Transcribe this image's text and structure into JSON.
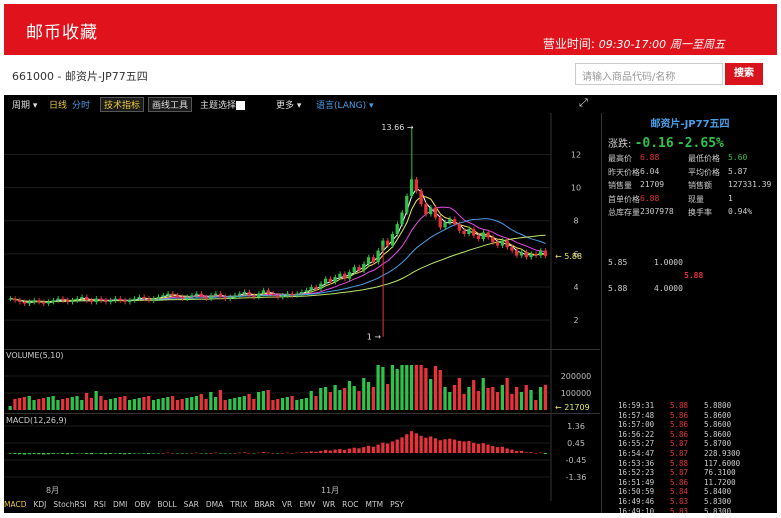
{
  "header": {
    "brand": "邮币收藏",
    "hours_label": "营业时间:",
    "hours_time": "09:30-17:00",
    "hours_days": "周一至周五",
    "bg_color": "#e0131c"
  },
  "topbar": {
    "product_code": "661000 - 邮资片-JP77五四",
    "search_placeholder": "请输入商品代码/名称",
    "search_button": "搜索"
  },
  "toolbar": {
    "period": "周期",
    "daily": "日线",
    "timeshare": "分时",
    "indicators": "技术指标",
    "draw_tools": "画线工具",
    "theme": "主题选择",
    "more": "更多",
    "language": "语言(LANG)",
    "fullscreen_icon": "expand-icon"
  },
  "quote": {
    "title": "邮资片-JP77五四",
    "change_label": "涨跌:",
    "change_value": "-0.16",
    "change_pct": "-2.65%",
    "rows": [
      {
        "k1": "最高价",
        "v1": "6.88",
        "k2": "最低价格",
        "v2": "5.60"
      },
      {
        "k1": "昨天价格",
        "v1": "6.04",
        "k2": "平均价格",
        "v2": "5.87"
      },
      {
        "k1": "销售量",
        "v1": "21709",
        "k2": "销售额",
        "v2": "127331.39"
      },
      {
        "k1": "首单价格",
        "v1": "6.88",
        "k2": "现量",
        "v2": "1"
      },
      {
        "k1": "总库存量",
        "v1": "2307978",
        "k2": "换手率",
        "v2": "0.94%"
      }
    ]
  },
  "order_book": {
    "sell": {
      "price": "5.85",
      "qty": "1.0000"
    },
    "last": "5.88",
    "buy": {
      "price": "5.88",
      "qty": "4.0000"
    }
  },
  "ticks": [
    {
      "time": "16:59:31",
      "price": "5.88",
      "vol": "5.8800"
    },
    {
      "time": "16:57:48",
      "price": "5.86",
      "vol": "5.8600"
    },
    {
      "time": "16:57:00",
      "price": "5.86",
      "vol": "5.8600"
    },
    {
      "time": "16:56:22",
      "price": "5.86",
      "vol": "5.8600"
    },
    {
      "time": "16:55:27",
      "price": "5.87",
      "vol": "5.8700"
    },
    {
      "time": "16:54:47",
      "price": "5.87",
      "vol": "228.9300"
    },
    {
      "time": "16:53:36",
      "price": "5.88",
      "vol": "117.6000"
    },
    {
      "time": "16:52:23",
      "price": "5.87",
      "vol": "76.3100"
    },
    {
      "time": "16:51:49",
      "price": "5.86",
      "vol": "11.7200"
    },
    {
      "time": "16:50:59",
      "price": "5.84",
      "vol": "5.8400"
    },
    {
      "time": "16:49:46",
      "price": "5.83",
      "vol": "5.8300"
    },
    {
      "time": "16:49:10",
      "price": "5.83",
      "vol": "5.8300"
    }
  ],
  "panels": {
    "volume_label": "VOLUME(5,10)",
    "macd_label": "MACD(12,26,9)"
  },
  "bottom_tabs": [
    "MACD",
    "KDJ",
    "StochRSI",
    "RSI",
    "DMI",
    "OBV",
    "BOLL",
    "SAR",
    "DMA",
    "TRIX",
    "BRAR",
    "VR",
    "EMV",
    "WR",
    "ROC",
    "MTM",
    "PSY"
  ],
  "chart_data": {
    "type": "candlestick",
    "x_labels": [
      "8月",
      "11月"
    ],
    "price_axis_ticks": [
      "2",
      "4",
      "6",
      "8",
      "10",
      "12"
    ],
    "price_range": [
      0.5,
      13.9
    ],
    "high_annotation": "13.66",
    "low_annotation": "1",
    "last_price": "5.88",
    "volume_axis_ticks": [
      "200000",
      "100000"
    ],
    "volume_last": "21709",
    "macd_axis_ticks": [
      "1.36",
      "0.45",
      "-0.45",
      "-1.36"
    ],
    "closes": [
      3.3,
      3.2,
      3.1,
      3.0,
      3.1,
      3.2,
      3.1,
      3.0,
      3.1,
      3.2,
      3.3,
      3.2,
      3.1,
      3.2,
      3.3,
      3.4,
      3.2,
      3.1,
      3.3,
      3.2,
      3.1,
      3.2,
      3.3,
      3.2,
      3.1,
      3.2,
      3.3,
      3.4,
      3.3,
      3.2,
      3.3,
      3.4,
      3.5,
      3.6,
      3.5,
      3.4,
      3.3,
      3.4,
      3.5,
      3.6,
      3.4,
      3.3,
      3.5,
      3.6,
      3.4,
      3.3,
      3.4,
      3.5,
      3.6,
      3.7,
      3.5,
      3.4,
      3.6,
      3.8,
      3.6,
      3.5,
      3.4,
      3.5,
      3.6,
      3.5,
      3.6,
      3.7,
      3.8,
      4.0,
      3.9,
      4.2,
      4.5,
      4.3,
      4.6,
      4.8,
      4.5,
      4.9,
      5.2,
      5.0,
      5.4,
      5.8,
      5.5,
      6.2,
      6.8,
      6.5,
      7.2,
      7.8,
      8.5,
      9.5,
      10.5,
      9.8,
      9.0,
      8.4,
      8.8,
      8.2,
      7.6,
      7.9,
      8.1,
      7.8,
      7.4,
      7.2,
      7.5,
      7.1,
      6.9,
      7.3,
      7.0,
      6.7,
      6.5,
      6.8,
      6.4,
      6.2,
      5.9,
      6.1,
      5.8,
      6.0,
      5.9,
      6.2,
      5.88
    ],
    "ma_colors": [
      "#ffffff",
      "#e8e85a",
      "#e84ae8",
      "#4a9ee8",
      "#b8e86a"
    ],
    "colors": {
      "up": "#2ec24a",
      "down": "#e8323a"
    }
  }
}
